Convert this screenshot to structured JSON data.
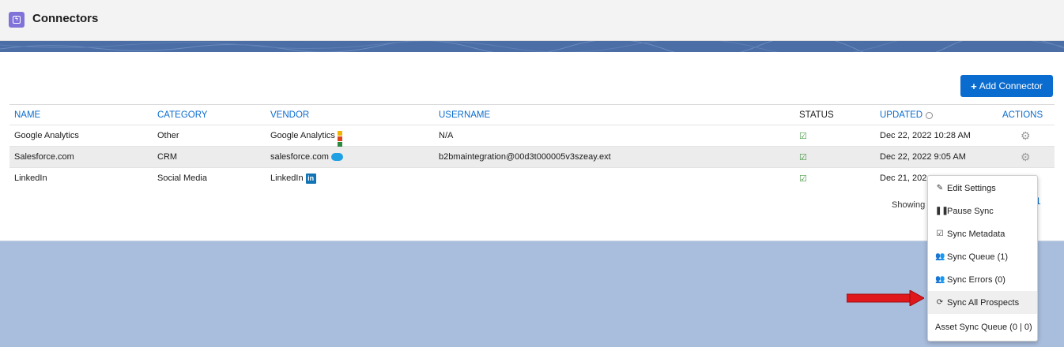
{
  "header": {
    "title": "Connectors",
    "icon": "lightning-bolt-icon"
  },
  "toolbar": {
    "add_connector_label": "Add Connector"
  },
  "table": {
    "columns": {
      "name": "NAME",
      "category": "CATEGORY",
      "vendor": "VENDOR",
      "username": "USERNAME",
      "status": "STATUS",
      "updated": "UPDATED",
      "actions": "ACTIONS"
    },
    "rows": [
      {
        "name": "Google Analytics",
        "category": "Other",
        "vendor": "Google Analytics",
        "vendor_icon": "google-analytics-icon",
        "username": "N/A",
        "status_icon": "check-square-icon",
        "updated": "Dec 22, 2022 10:28 AM"
      },
      {
        "name": "Salesforce.com",
        "category": "CRM",
        "vendor": "salesforce.com",
        "vendor_icon": "salesforce-cloud-icon",
        "username": "b2bmaintegration@00d3t000005v3szeay.ext",
        "status_icon": "check-square-icon",
        "updated": "Dec 22, 2022 9:05 AM"
      },
      {
        "name": "LinkedIn",
        "category": "Social Media",
        "vendor": "LinkedIn",
        "vendor_icon": "linkedin-icon",
        "username": "",
        "status_icon": "check-square-icon",
        "updated": "Dec 21, 202"
      }
    ]
  },
  "footer": {
    "showing": "Showing",
    "page": "1"
  },
  "dropdown": {
    "items": [
      {
        "label": "Edit Settings",
        "icon": "edit-icon"
      },
      {
        "label": "Pause Sync",
        "icon": "pause-icon"
      },
      {
        "label": "Sync Metadata",
        "icon": "check-square-icon"
      },
      {
        "label": "Sync Queue (1)",
        "icon": "users-icon"
      },
      {
        "label": "Sync Errors (0)",
        "icon": "users-icon"
      },
      {
        "label": "Sync All Prospects",
        "icon": "refresh-icon"
      },
      {
        "label": "Asset Sync Queue (0 | 0)",
        "icon": ""
      }
    ]
  },
  "colors": {
    "accent": "#0b6ccf",
    "band": "#4b6ea6",
    "background": "#a9bedd",
    "app_icon": "#7f72d8",
    "arrow": "#e0171b"
  }
}
